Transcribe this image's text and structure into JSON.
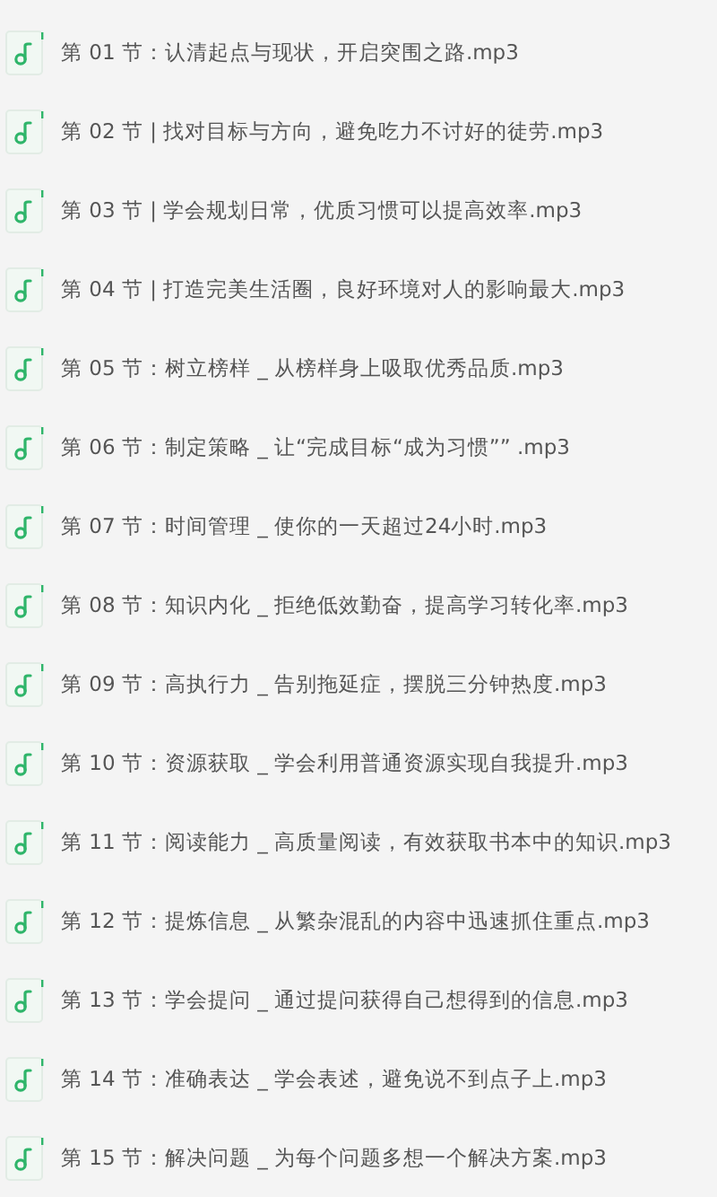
{
  "files": [
    {
      "name": "第 01 节：认清起点与现状，开启突围之路.mp3"
    },
    {
      "name": "第 02 节 | 找对目标与方向，避免吃力不讨好的徒劳.mp3"
    },
    {
      "name": "第 03 节 | 学会规划日常，优质习惯可以提高效率.mp3"
    },
    {
      "name": "第 04 节 | 打造完美生活圈，良好环境对人的影响最大.mp3"
    },
    {
      "name": "第 05 节：树立榜样 _ 从榜样身上吸取优秀品质.mp3"
    },
    {
      "name": "第 06 节：制定策略 _ 让“完成目标“成为习惯”” .mp3"
    },
    {
      "name": "第 07 节：时间管理 _ 使你的一天超过24小时.mp3"
    },
    {
      "name": "第 08 节：知识内化 _ 拒绝低效勤奋，提高学习转化率.mp3"
    },
    {
      "name": "第 09 节：高执行力 _ 告别拖延症，摆脱三分钟热度.mp3"
    },
    {
      "name": "第 10 节：资源获取 _ 学会利用普通资源实现自我提升.mp3"
    },
    {
      "name": "第 11 节：阅读能力 _ 高质量阅读，有效获取书本中的知识.mp3"
    },
    {
      "name": "第 12 节：提炼信息 _ 从繁杂混乱的内容中迅速抓住重点.mp3"
    },
    {
      "name": "第 13 节：学会提问 _ 通过提问获得自己想得到的信息.mp3"
    },
    {
      "name": "第 14 节：准确表达 _ 学会表述，避免说不到点子上.mp3"
    },
    {
      "name": "第 15 节：解决问题 _ 为每个问题多想一个解决方案.mp3"
    }
  ]
}
